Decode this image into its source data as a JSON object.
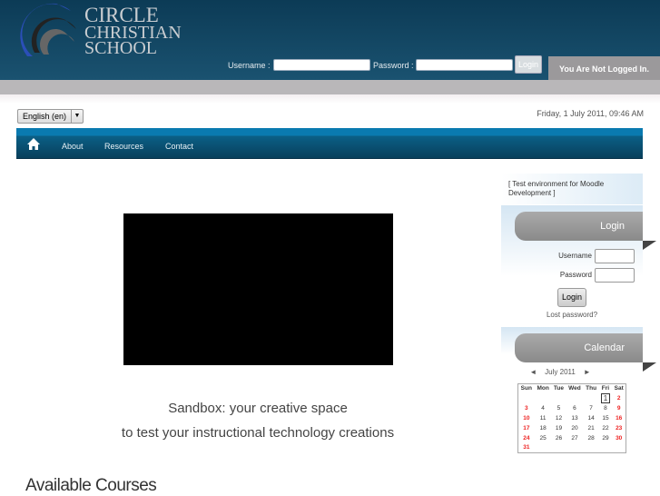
{
  "header": {
    "logo": [
      "Circle",
      "Christian",
      "School"
    ],
    "username_label": "Username :",
    "password_label": "Password :",
    "login_button": "Login",
    "status": "You Are Not Logged In."
  },
  "language": {
    "selected": "English (en)"
  },
  "date": "Friday, 1 July 2011, 09:46 AM",
  "nav": {
    "items": [
      "About",
      "Resources",
      "Contact"
    ]
  },
  "main": {
    "tagline1": "Sandbox: your creative space",
    "tagline2": "to test your instructional technology creations",
    "available_courses": "Available Courses"
  },
  "sidebar": {
    "test_env": "[ Test environment for Moodle Development ]",
    "login": {
      "title": "Login",
      "username": "Username",
      "password": "Password",
      "button": "Login",
      "lost": "Lost password?"
    },
    "calendar": {
      "title": "Calendar",
      "month": "July 2011",
      "prev": "◄",
      "next": "►",
      "days": [
        "Sun",
        "Mon",
        "Tue",
        "Wed",
        "Thu",
        "Fri",
        "Sat"
      ],
      "weeks": [
        [
          "",
          "",
          "",
          "",
          "",
          "1",
          "2"
        ],
        [
          "3",
          "4",
          "5",
          "6",
          "7",
          "8",
          "9"
        ],
        [
          "10",
          "11",
          "12",
          "13",
          "14",
          "15",
          "16"
        ],
        [
          "17",
          "18",
          "19",
          "20",
          "21",
          "22",
          "23"
        ],
        [
          "24",
          "25",
          "26",
          "27",
          "28",
          "29",
          "30"
        ],
        [
          "31",
          "",
          "",
          "",
          "",
          "",
          ""
        ]
      ],
      "today": "1"
    }
  },
  "colors": {
    "header": "#0c3b56",
    "nav": "#0b5f86",
    "weekend": "#e22222"
  }
}
